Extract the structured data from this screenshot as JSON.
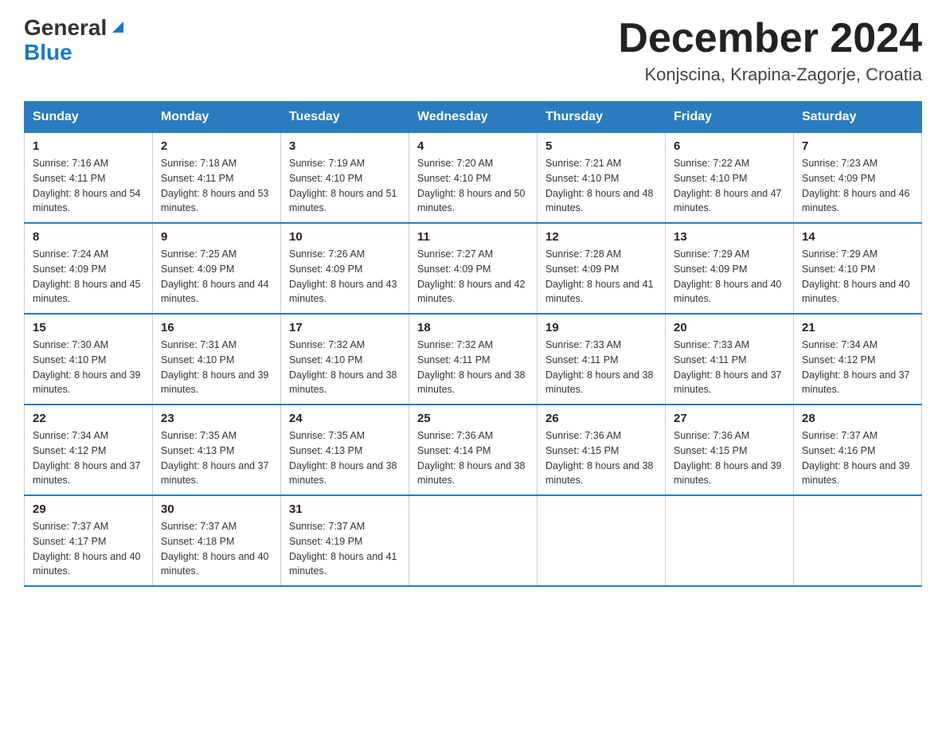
{
  "header": {
    "logo": {
      "general": "General",
      "blue": "Blue"
    },
    "title": "December 2024",
    "location": "Konjscina, Krapina-Zagorje, Croatia"
  },
  "weekdays": [
    "Sunday",
    "Monday",
    "Tuesday",
    "Wednesday",
    "Thursday",
    "Friday",
    "Saturday"
  ],
  "weeks": [
    [
      {
        "day": "1",
        "sunrise": "7:16 AM",
        "sunset": "4:11 PM",
        "daylight": "8 hours and 54 minutes."
      },
      {
        "day": "2",
        "sunrise": "7:18 AM",
        "sunset": "4:11 PM",
        "daylight": "8 hours and 53 minutes."
      },
      {
        "day": "3",
        "sunrise": "7:19 AM",
        "sunset": "4:10 PM",
        "daylight": "8 hours and 51 minutes."
      },
      {
        "day": "4",
        "sunrise": "7:20 AM",
        "sunset": "4:10 PM",
        "daylight": "8 hours and 50 minutes."
      },
      {
        "day": "5",
        "sunrise": "7:21 AM",
        "sunset": "4:10 PM",
        "daylight": "8 hours and 48 minutes."
      },
      {
        "day": "6",
        "sunrise": "7:22 AM",
        "sunset": "4:10 PM",
        "daylight": "8 hours and 47 minutes."
      },
      {
        "day": "7",
        "sunrise": "7:23 AM",
        "sunset": "4:09 PM",
        "daylight": "8 hours and 46 minutes."
      }
    ],
    [
      {
        "day": "8",
        "sunrise": "7:24 AM",
        "sunset": "4:09 PM",
        "daylight": "8 hours and 45 minutes."
      },
      {
        "day": "9",
        "sunrise": "7:25 AM",
        "sunset": "4:09 PM",
        "daylight": "8 hours and 44 minutes."
      },
      {
        "day": "10",
        "sunrise": "7:26 AM",
        "sunset": "4:09 PM",
        "daylight": "8 hours and 43 minutes."
      },
      {
        "day": "11",
        "sunrise": "7:27 AM",
        "sunset": "4:09 PM",
        "daylight": "8 hours and 42 minutes."
      },
      {
        "day": "12",
        "sunrise": "7:28 AM",
        "sunset": "4:09 PM",
        "daylight": "8 hours and 41 minutes."
      },
      {
        "day": "13",
        "sunrise": "7:29 AM",
        "sunset": "4:09 PM",
        "daylight": "8 hours and 40 minutes."
      },
      {
        "day": "14",
        "sunrise": "7:29 AM",
        "sunset": "4:10 PM",
        "daylight": "8 hours and 40 minutes."
      }
    ],
    [
      {
        "day": "15",
        "sunrise": "7:30 AM",
        "sunset": "4:10 PM",
        "daylight": "8 hours and 39 minutes."
      },
      {
        "day": "16",
        "sunrise": "7:31 AM",
        "sunset": "4:10 PM",
        "daylight": "8 hours and 39 minutes."
      },
      {
        "day": "17",
        "sunrise": "7:32 AM",
        "sunset": "4:10 PM",
        "daylight": "8 hours and 38 minutes."
      },
      {
        "day": "18",
        "sunrise": "7:32 AM",
        "sunset": "4:11 PM",
        "daylight": "8 hours and 38 minutes."
      },
      {
        "day": "19",
        "sunrise": "7:33 AM",
        "sunset": "4:11 PM",
        "daylight": "8 hours and 38 minutes."
      },
      {
        "day": "20",
        "sunrise": "7:33 AM",
        "sunset": "4:11 PM",
        "daylight": "8 hours and 37 minutes."
      },
      {
        "day": "21",
        "sunrise": "7:34 AM",
        "sunset": "4:12 PM",
        "daylight": "8 hours and 37 minutes."
      }
    ],
    [
      {
        "day": "22",
        "sunrise": "7:34 AM",
        "sunset": "4:12 PM",
        "daylight": "8 hours and 37 minutes."
      },
      {
        "day": "23",
        "sunrise": "7:35 AM",
        "sunset": "4:13 PM",
        "daylight": "8 hours and 37 minutes."
      },
      {
        "day": "24",
        "sunrise": "7:35 AM",
        "sunset": "4:13 PM",
        "daylight": "8 hours and 38 minutes."
      },
      {
        "day": "25",
        "sunrise": "7:36 AM",
        "sunset": "4:14 PM",
        "daylight": "8 hours and 38 minutes."
      },
      {
        "day": "26",
        "sunrise": "7:36 AM",
        "sunset": "4:15 PM",
        "daylight": "8 hours and 38 minutes."
      },
      {
        "day": "27",
        "sunrise": "7:36 AM",
        "sunset": "4:15 PM",
        "daylight": "8 hours and 39 minutes."
      },
      {
        "day": "28",
        "sunrise": "7:37 AM",
        "sunset": "4:16 PM",
        "daylight": "8 hours and 39 minutes."
      }
    ],
    [
      {
        "day": "29",
        "sunrise": "7:37 AM",
        "sunset": "4:17 PM",
        "daylight": "8 hours and 40 minutes."
      },
      {
        "day": "30",
        "sunrise": "7:37 AM",
        "sunset": "4:18 PM",
        "daylight": "8 hours and 40 minutes."
      },
      {
        "day": "31",
        "sunrise": "7:37 AM",
        "sunset": "4:19 PM",
        "daylight": "8 hours and 41 minutes."
      },
      null,
      null,
      null,
      null
    ]
  ]
}
